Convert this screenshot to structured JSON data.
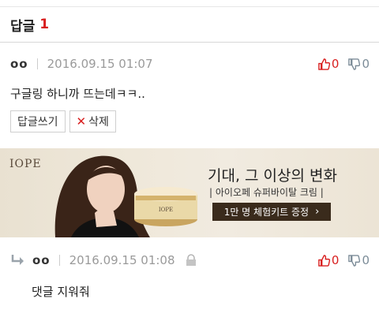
{
  "header": {
    "title": "답글",
    "count": "1"
  },
  "comment": {
    "author": "oo",
    "date": "2016.09.15 01:07",
    "text": "구글링 하니까 뜨는데ㅋㅋ..",
    "up_count": "0",
    "down_count": "0",
    "reply_button": "답글쓰기",
    "delete_button": "삭제"
  },
  "ad": {
    "brand": "IOPE",
    "headline": "기대, 그 이상의 변화",
    "sub": "| 아이오페 슈퍼바이탈 크림 |",
    "cta": "1만 명 체험키트 증정",
    "product_label": "IOPE"
  },
  "reply": {
    "author": "oo",
    "date": "2016.09.15 01:08",
    "text": "댓글 지워줘",
    "up_count": "0",
    "down_count": "0"
  },
  "colors": {
    "accent_red": "#d81e1e",
    "muted_blue": "#7c8c98",
    "cta_bg": "#3a2b1c"
  }
}
